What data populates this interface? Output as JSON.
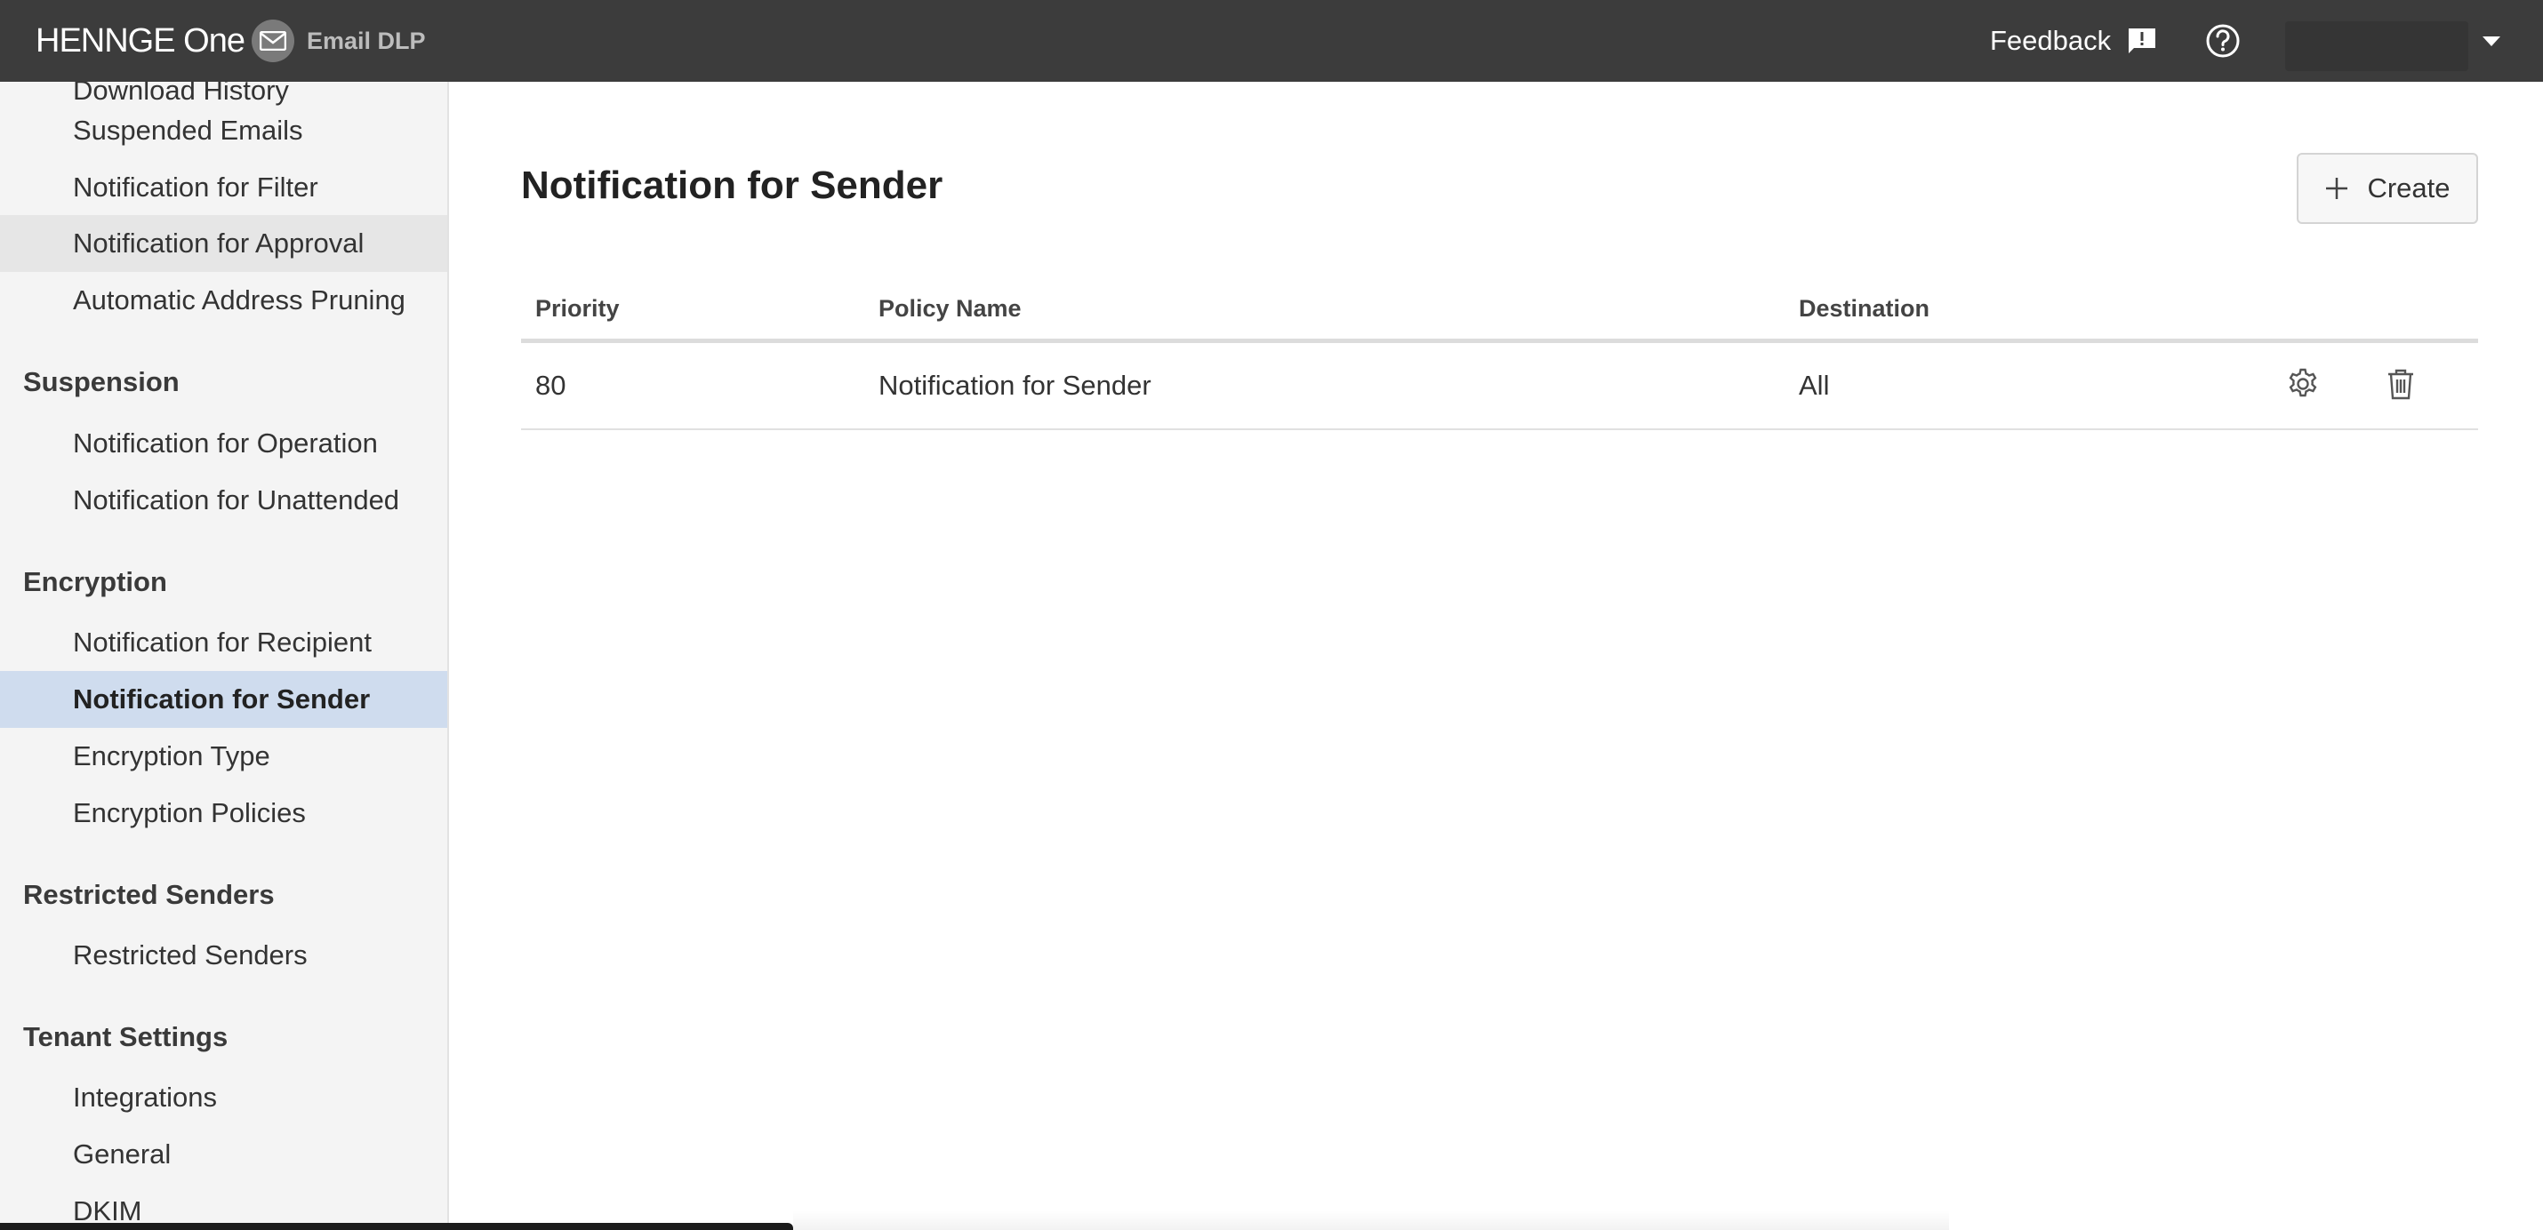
{
  "header": {
    "brand": "HENNGE One",
    "product": "Email DLP",
    "feedback_label": "Feedback",
    "icons": [
      "envelope-icon",
      "feedback-icon",
      "help-icon",
      "chevron-down-icon"
    ]
  },
  "sidebar": {
    "items_top": [
      {
        "label": "Download History"
      },
      {
        "label": "Suspended Emails"
      },
      {
        "label": "Notification for Filter"
      },
      {
        "label": "Notification for Approval"
      },
      {
        "label": "Automatic Address Pruning"
      }
    ],
    "sections": [
      {
        "title": "Suspension",
        "items": [
          "Notification for Operation",
          "Notification for Unattended"
        ]
      },
      {
        "title": "Encryption",
        "items": [
          "Notification for Recipient",
          "Notification for Sender",
          "Encryption Type",
          "Encryption Policies"
        ]
      },
      {
        "title": "Restricted Senders",
        "items": [
          "Restricted Senders"
        ]
      },
      {
        "title": "Tenant Settings",
        "items": [
          "Integrations",
          "General",
          "DKIM"
        ]
      }
    ],
    "active_item": "Notification for Sender",
    "hovered_item": "Notification for Approval"
  },
  "main": {
    "title": "Notification for Sender",
    "create_label": "Create",
    "table": {
      "columns": [
        "Priority",
        "Policy Name",
        "Destination"
      ],
      "rows": [
        {
          "priority": "80",
          "policy_name": "Notification for Sender",
          "destination": "All"
        }
      ]
    }
  },
  "colors": {
    "header_bg": "#3c3c3c",
    "sidebar_bg": "#f4f4f4",
    "active_bg": "#cfdcee",
    "hover_bg": "#e6e6e6"
  }
}
